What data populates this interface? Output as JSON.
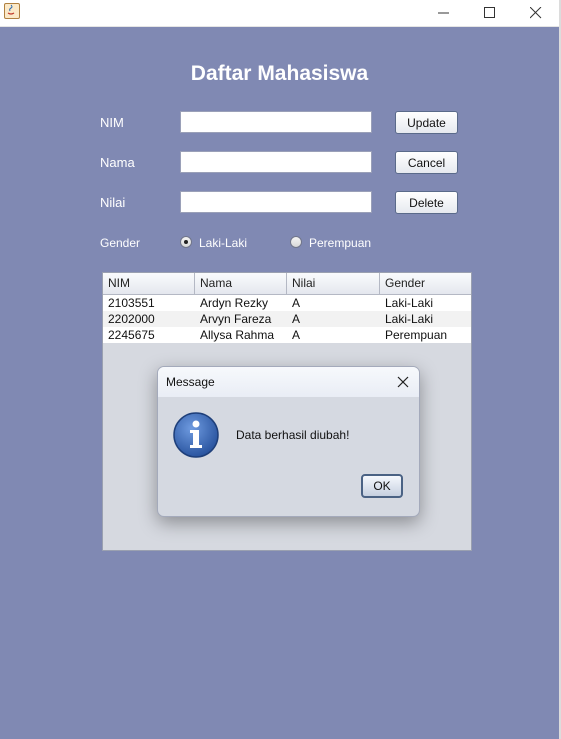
{
  "window": {
    "minimize_icon": "minimize-icon",
    "maximize_icon": "maximize-icon",
    "close_icon": "close-icon"
  },
  "colors": {
    "background": "#8089b3",
    "title_text": "#ffffff",
    "dialog_bg": "#d5d9e1",
    "info_icon": "#2f5fa8"
  },
  "form": {
    "title": "Daftar Mahasiswa",
    "nim_label": "NIM",
    "nama_label": "Nama",
    "nilai_label": "Nilai",
    "nim_value": "",
    "nama_value": "",
    "nilai_value": "",
    "update_label": "Update",
    "cancel_label": "Cancel",
    "delete_label": "Delete",
    "gender_label": "Gender",
    "gender_options": [
      "Laki-Laki",
      "Perempuan"
    ],
    "gender_selected": "Laki-Laki"
  },
  "table": {
    "headers": [
      "NIM",
      "Nama",
      "Nilai",
      "Gender"
    ],
    "rows": [
      [
        "2103551",
        "Ardyn Rezky",
        "A",
        "Laki-Laki"
      ],
      [
        "2202000",
        "Arvyn Fareza",
        "A",
        "Laki-Laki"
      ],
      [
        "2245675",
        "Allysa Rahma",
        "A",
        "Perempuan"
      ]
    ]
  },
  "dialog": {
    "title": "Message",
    "message": "Data berhasil diubah!",
    "ok_label": "OK",
    "icon": "info-icon"
  }
}
